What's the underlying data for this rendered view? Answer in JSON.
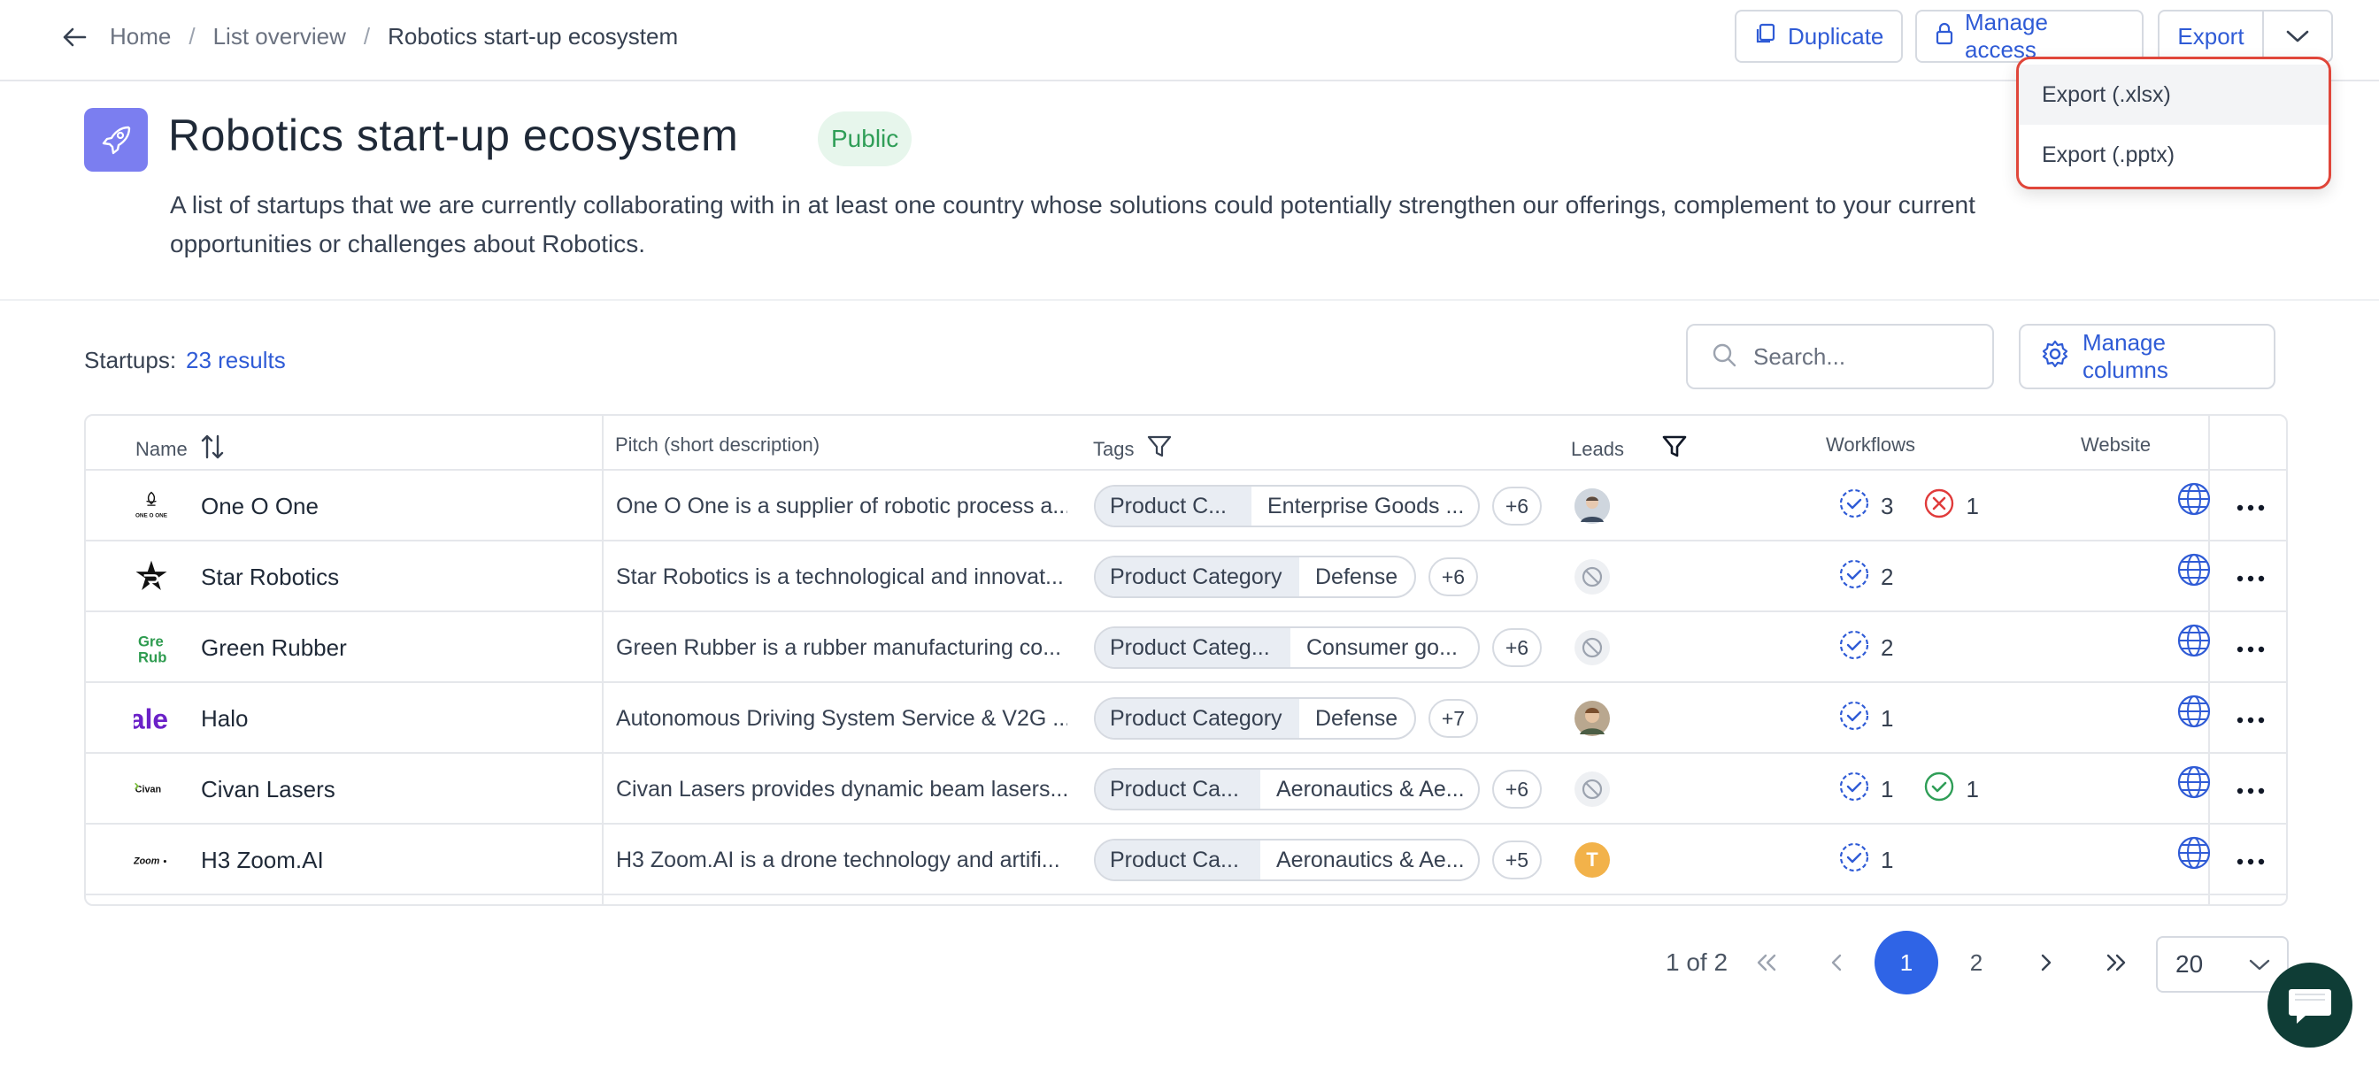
{
  "breadcrumb": {
    "home": "Home",
    "sep": "/",
    "list_overview": "List overview",
    "current": "Robotics start-up ecosystem"
  },
  "toolbar": {
    "duplicate": "Duplicate",
    "manage_access": "Manage access",
    "export": "Export"
  },
  "export_menu": {
    "items": [
      "Export (.xlsx)",
      "Export (.pptx)"
    ]
  },
  "header": {
    "title": "Robotics start-up ecosystem",
    "badge": "Public",
    "description": "A list of startups that we are currently collaborating with in at least one country whose solutions could potentially strengthen our offerings, complement to your current opportunities or challenges about Robotics."
  },
  "results": {
    "label": "Startups:",
    "count": "23 results"
  },
  "search": {
    "placeholder": "Search..."
  },
  "manage_columns": "Manage columns",
  "table": {
    "columns": [
      "Name",
      "Pitch (short description)",
      "Tags",
      "Leads",
      "Workflows",
      "Website"
    ],
    "rows": [
      {
        "name": "One O One",
        "logo": "ONE O ONE",
        "pitch": "One O One is a supplier of robotic process a...",
        "tag_a": "Product C...",
        "tag_b": "Enterprise Goods ...",
        "tag_more": "+6",
        "lead": "photo",
        "wf_pending": "3",
        "wf_rejected": "1",
        "wf_done": ""
      },
      {
        "name": "Star Robotics",
        "logo": "star",
        "pitch": "Star Robotics is a technological and innovat...",
        "tag_a": "Product Category",
        "tag_b": "Defense",
        "tag_more": "+6",
        "lead": "none",
        "wf_pending": "2",
        "wf_rejected": "",
        "wf_done": ""
      },
      {
        "name": "Green Rubber",
        "logo": "Gre Rub",
        "pitch": "Green Rubber is a rubber manufacturing co...",
        "tag_a": "Product Categ...",
        "tag_b": "Consumer go...",
        "tag_more": "+6",
        "lead": "none",
        "wf_pending": "2",
        "wf_rejected": "",
        "wf_done": ""
      },
      {
        "name": "Halo",
        "logo": "ale",
        "pitch": "Autonomous Driving System Service & V2G ...",
        "tag_a": "Product Category",
        "tag_b": "Defense",
        "tag_more": "+7",
        "lead": "photo",
        "wf_pending": "1",
        "wf_rejected": "",
        "wf_done": ""
      },
      {
        "name": "Civan Lasers",
        "logo": "Civan",
        "pitch": "Civan Lasers provides dynamic beam lasers...",
        "tag_a": "Product Ca...",
        "tag_b": "Aeronautics & Ae...",
        "tag_more": "+6",
        "lead": "none",
        "wf_pending": "1",
        "wf_rejected": "",
        "wf_done": "1"
      },
      {
        "name": "H3 Zoom.AI",
        "logo": "Zoom",
        "pitch": "H3 Zoom.AI is a drone technology and artifi...",
        "tag_a": "Product Ca...",
        "tag_b": "Aeronautics & Ae...",
        "tag_more": "+5",
        "lead": "T",
        "wf_pending": "1",
        "wf_rejected": "",
        "wf_done": ""
      }
    ]
  },
  "pagination": {
    "summary": "1 of 2",
    "pages": [
      "1",
      "2"
    ],
    "current": "1",
    "page_size": "20"
  },
  "colors": {
    "accent": "#2f5bd6",
    "badge_bg": "#e7f6ec",
    "badge_text": "#2f9e57",
    "highlight": "#e0463a",
    "active_page": "#2f64e6",
    "rejected": "#e03b3b",
    "done": "#2f9e57"
  }
}
